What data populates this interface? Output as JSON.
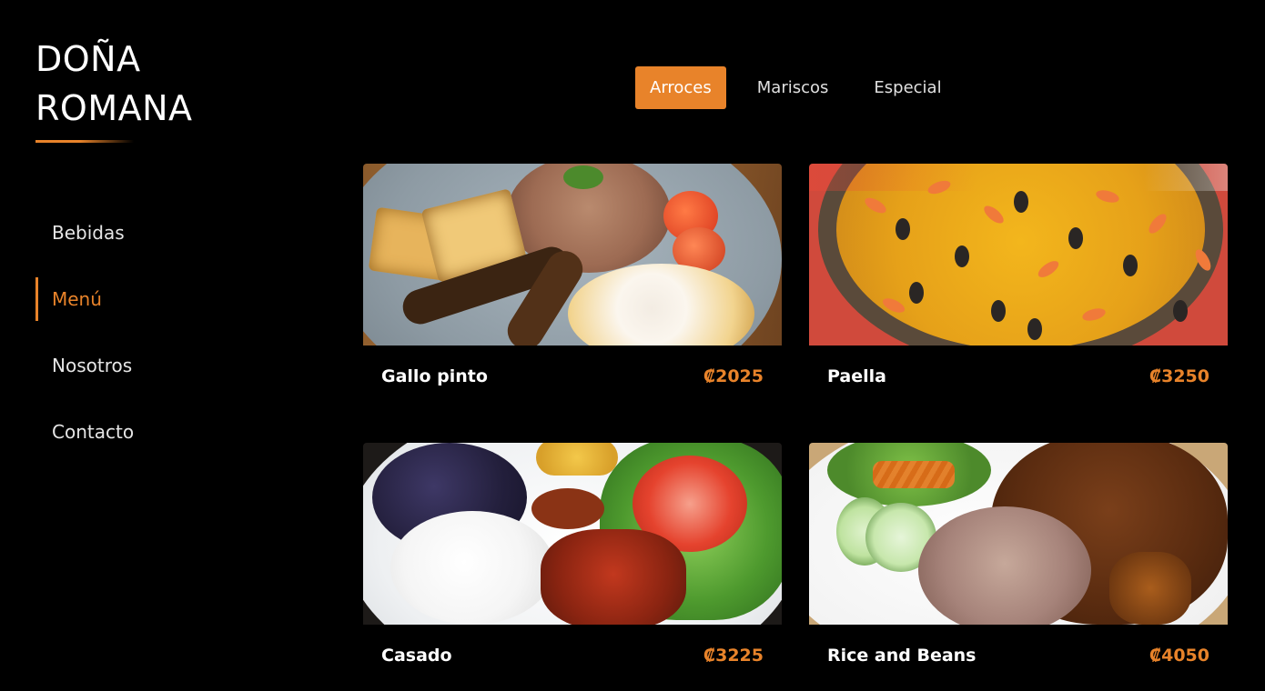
{
  "brand": {
    "line1": "DOÑA",
    "line2": "ROMANA",
    "accent_color": "#e8832a"
  },
  "sidebar": {
    "items": [
      {
        "label": "Bebidas",
        "active": false
      },
      {
        "label": "Menú",
        "active": true
      },
      {
        "label": "Nosotros",
        "active": false
      },
      {
        "label": "Contacto",
        "active": false
      }
    ]
  },
  "tabs": [
    {
      "label": "Arroces",
      "active": true
    },
    {
      "label": "Mariscos",
      "active": false
    },
    {
      "label": "Especial",
      "active": false
    }
  ],
  "dishes": [
    {
      "name": "Gallo pinto",
      "price": "₡2025",
      "image": "gallo-pinto-photo"
    },
    {
      "name": "Paella",
      "price": "₡3250",
      "image": "paella-photo"
    },
    {
      "name": "Casado",
      "price": "₡3225",
      "image": "casado-photo"
    },
    {
      "name": "Rice and Beans",
      "price": "₡4050",
      "image": "rice-and-beans-photo"
    }
  ],
  "colors": {
    "background": "#000000",
    "accent": "#e8832a",
    "text": "#ffffff"
  }
}
